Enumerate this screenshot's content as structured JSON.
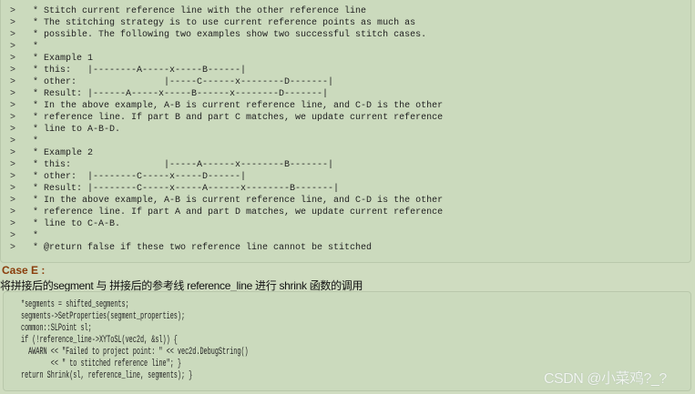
{
  "quote_lines": [
    "* Stitch current reference line with the other reference line",
    "* The stitching strategy is to use current reference points as much as",
    "* possible. The following two examples show two successful stitch cases.",
    "*",
    "* Example 1",
    "* this:   |--------A-----x-----B------|",
    "* other:                |-----C------x--------D-------|",
    "* Result: |------A-----x-----B------x--------D-------|",
    "* In the above example, A-B is current reference line, and C-D is the other",
    "* reference line. If part B and part C matches, we update current reference",
    "* line to A-B-D.",
    "*",
    "* Example 2",
    "* this:                 |-----A------x--------B-------|",
    "* other:  |--------C-----x-----D------|",
    "* Result: |--------C-----x-----A------x--------B-------|",
    "* In the above example, A-B is current reference line, and C-D is the other",
    "* reference line. If part A and part D matches, we update current reference",
    "* line to C-A-B.",
    "*",
    "* @return false if these two reference line cannot be stitched"
  ],
  "quote_marker": ">",
  "case_title": "Case E :",
  "case_desc": "将拼接后的segment 与 拼接后的参考线 reference_line 进行 shrink 函数的调用",
  "code_lines": [
    "*segments = shifted_segments;",
    "segments->SetProperties(segment_properties);",
    "common::SLPoint sl;",
    "if (!reference_line->XYToSL(vec2d, &sl)) {",
    "  AWARN << \"Failed to project point: \" << vec2d.DebugString()",
    "        << \" to stitched reference line\"; }",
    "return Shrink(sl, reference_line, segments); }"
  ],
  "watermark": "CSDN @小菜鸡?_?"
}
